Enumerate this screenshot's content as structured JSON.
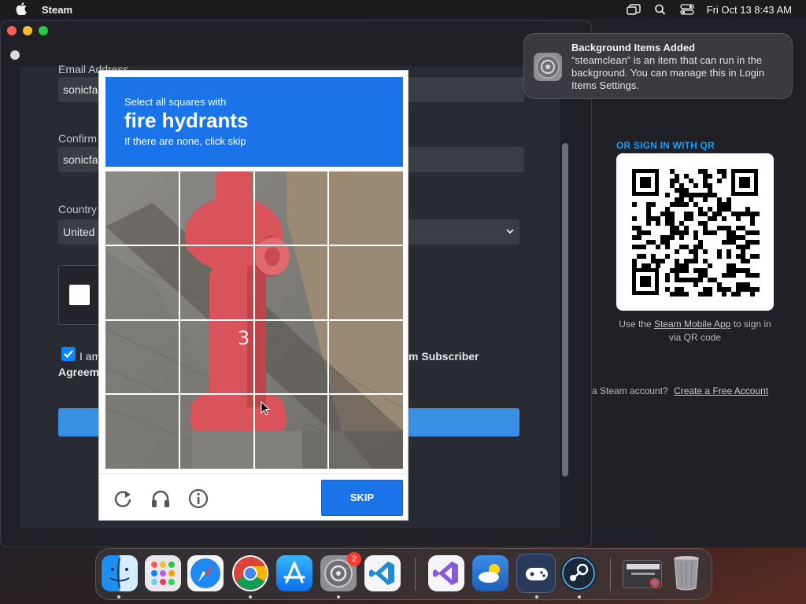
{
  "menubar": {
    "app_name": "Steam",
    "datetime": "Fri Oct 13  8:43 AM",
    "icons": [
      "apple-icon",
      "window-icon",
      "search-icon",
      "control-center-icon"
    ]
  },
  "form": {
    "email_label": "Email Address",
    "email_value": "sonicfa",
    "confirm_label": "Confirm",
    "confirm_value": "sonicfa",
    "country_label": "Country",
    "country_value": "United",
    "agree_prefix": "I am",
    "agree_suffix": "m Subscriber",
    "agree_line2": "Agreem"
  },
  "qr": {
    "title": "OR SIGN IN WITH QR",
    "text_before": "Use the ",
    "link": "Steam Mobile App",
    "text_after": " to sign in via QR code"
  },
  "create": {
    "prompt": "a Steam account?",
    "link": "Create a Free Account"
  },
  "notification": {
    "title": "Background Items Added",
    "body": "“steamclean” is an item that can run in the background. You can manage this in Login Items Settings."
  },
  "captcha": {
    "line1": "Select all squares with",
    "target": "fire hydrants",
    "line3": "If there are none, click skip",
    "skip_label": "SKIP",
    "controls": [
      "reload-icon",
      "audio-icon",
      "info-icon"
    ]
  },
  "dock": {
    "settings_badge": "2",
    "apps": [
      "Finder",
      "Launchpad",
      "Safari",
      "Chrome",
      "App Store",
      "System Settings",
      "VS Code",
      "Visual Studio",
      "Weather",
      "Game Controller",
      "Steam",
      "Google Chrome Window",
      "Trash"
    ]
  },
  "colors": {
    "captcha_blue": "#1a73e8",
    "steam_link_blue": "#1a9fff",
    "badge_red": "#ff3b30"
  }
}
